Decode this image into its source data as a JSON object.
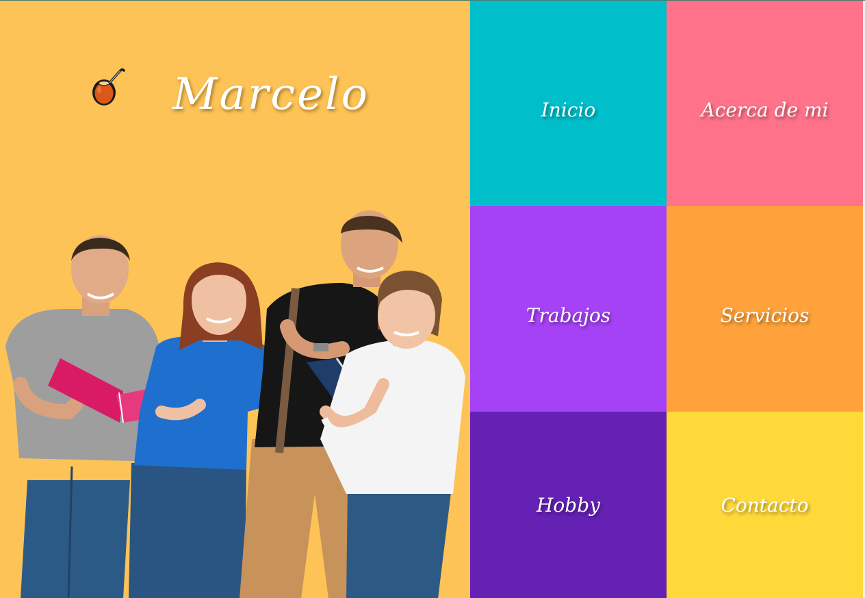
{
  "header": {
    "title": "Marcelo",
    "logo_icon": "mate-gourd-icon"
  },
  "hero": {
    "photo": "students-group-photo",
    "background_color": "#fdc356"
  },
  "nav": {
    "tiles": [
      {
        "label": "Inicio",
        "color": "#00bfca"
      },
      {
        "label": "Acerca de mi",
        "color": "#ff7289"
      },
      {
        "label": "Trabajos",
        "color": "#a642f5"
      },
      {
        "label": "Servicios",
        "color": "#ffa23b"
      },
      {
        "label": "Hobby",
        "color": "#6521b4"
      },
      {
        "label": "Contacto",
        "color": "#ffd83a"
      }
    ]
  }
}
